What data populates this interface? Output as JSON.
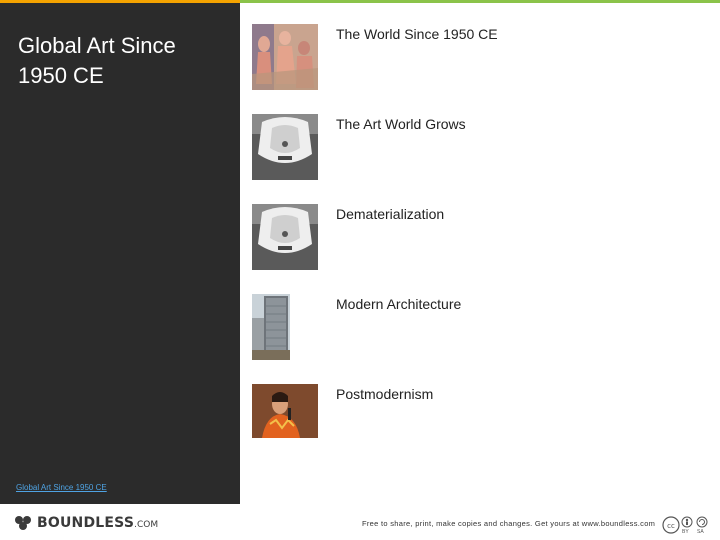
{
  "colors": {
    "accent_orange": "#f4a300",
    "accent_green": "#8bc34a",
    "panel": "#2b2b2b",
    "link": "#4fa3e3"
  },
  "sidebar": {
    "title": "Global Art Since 1950 CE",
    "footer_link": "Global Art Since 1950 CE"
  },
  "agenda": [
    {
      "label": "The World Since 1950 CE",
      "image": "painting-figures-thumbnail"
    },
    {
      "label": "The Art World Grows",
      "image": "urinal-sculpture-thumbnail"
    },
    {
      "label": "Dematerialization",
      "image": "urinal-sculpture-thumbnail"
    },
    {
      "label": "Modern Architecture",
      "image": "skyscraper-thumbnail"
    },
    {
      "label": "Postmodernism",
      "image": "speaker-portrait-thumbnail"
    }
  ],
  "footer": {
    "logo_word": "BOUNDLESS",
    "logo_suffix": ".COM",
    "note": "Free to share, print, make copies and changes. Get yours at www.boundless.com",
    "license_by": "BY",
    "license_sa": "SA"
  }
}
